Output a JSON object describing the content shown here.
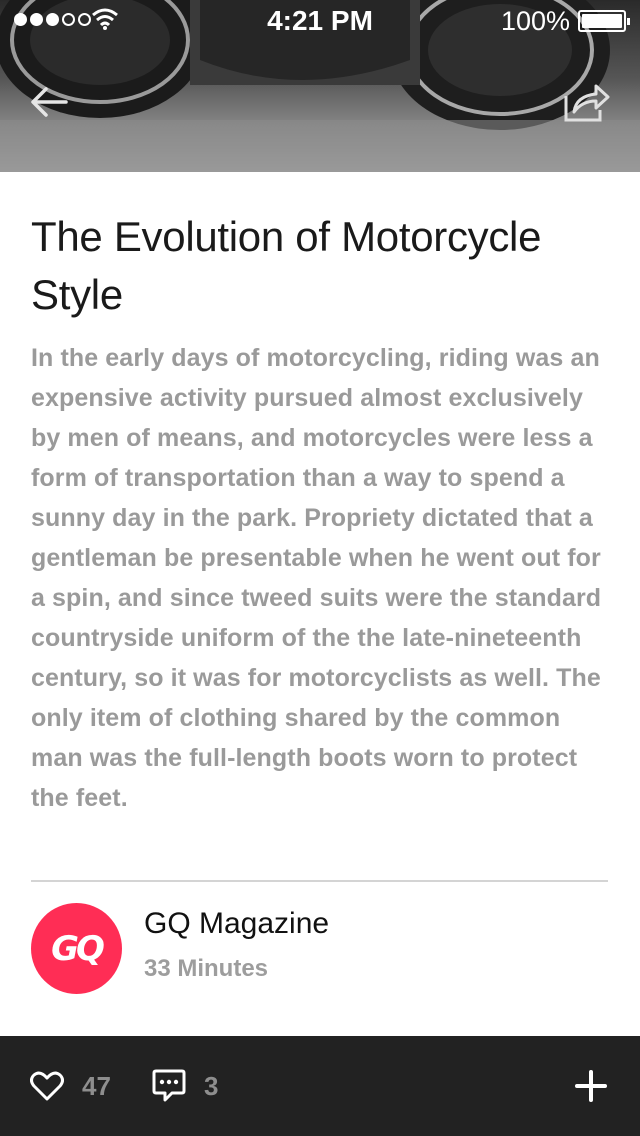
{
  "status_bar": {
    "time": "4:21 PM",
    "battery": "100%"
  },
  "header": {
    "back_icon": "arrow-left-icon",
    "share_icon": "share-icon"
  },
  "article": {
    "title": "The Evolution of Motorcycle Style",
    "body": "In the early days of motorcycling, riding was an expensive activity pursued almost exclu­sively by men of means, and motorcycles were less a form of transportation than a way to spend a sunny day in the park. Pro­priety dictated that a gentleman be present­able when he went out for a spin, and since tweed suits were the standard countryside uniform of the the late-nineteenth century, so it was for motorcyclists as well. The only item of clothing shared by the common man was the full-length boots worn to protect the feet."
  },
  "source": {
    "avatar_text": "GQ",
    "avatar_color": "#ff2d55",
    "name": "GQ Magazine",
    "time": "33 Minutes"
  },
  "actions": {
    "likes": "47",
    "comments": "3",
    "like_icon": "heart-icon",
    "comment_icon": "comment-icon",
    "add_icon": "plus-icon"
  },
  "colors": {
    "bottom_bar": "#222222",
    "body_text": "#9a9a9a"
  }
}
